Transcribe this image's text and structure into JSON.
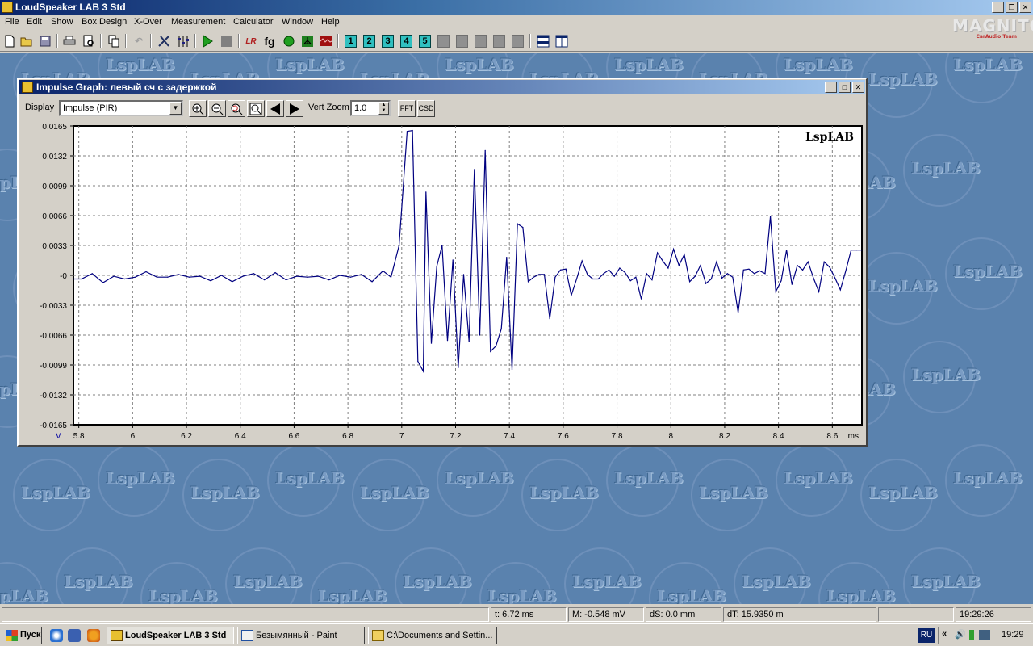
{
  "app": {
    "title": "LoudSpeaker LAB 3 Std"
  },
  "brand": {
    "logo_text": "MAGNITOLA",
    "logo_sub": "CarAudio Team"
  },
  "menu": [
    "File",
    "Edit",
    "Show",
    "Box Design",
    "X-Over",
    "Measurement",
    "Calculator",
    "Window",
    "Help"
  ],
  "toolbar": {
    "buttons": [
      "new-icon",
      "open-icon",
      "save-icon",
      "print-icon",
      "print-preview-icon",
      "copy-icon",
      "undo-icon",
      "tools-icon",
      "mixer-icon",
      "play-icon",
      "stop-icon",
      "lr-icon",
      "fg-icon",
      "circle-icon",
      "tree-icon",
      "waveform-icon"
    ],
    "lr_label": "LR",
    "fg_label": "fg",
    "number_buttons": [
      "1",
      "2",
      "3",
      "4",
      "5"
    ]
  },
  "watermark": {
    "text": "LspLAB"
  },
  "child_window": {
    "title": "Impulse Graph: левый сч с задержкой",
    "display_label": "Display",
    "display_value": "Impulse (PIR)",
    "vert_zoom_label": "Vert Zoom",
    "vert_zoom_value": "1.0",
    "fft_label": "FFT",
    "csd_label": "CSD"
  },
  "chart_data": {
    "type": "line",
    "title": "",
    "watermark": "LspLAB",
    "xlabel": "ms",
    "ylabel": "V",
    "xlim": [
      5.78,
      8.71
    ],
    "ylim": [
      -0.0165,
      0.0165
    ],
    "grid": true,
    "x_ticks": [
      "5.8",
      "6",
      "6.2",
      "6.4",
      "6.6",
      "6.8",
      "7",
      "7.2",
      "7.4",
      "7.6",
      "7.8",
      "8",
      "8.2",
      "8.4",
      "8.6"
    ],
    "y_ticks": [
      "0.0165",
      "0.0132",
      "0.0099",
      "0.0066",
      "0.0033",
      "-0",
      "-0.0033",
      "-0.0066",
      "-0.0099",
      "-0.0132",
      "-0.0165"
    ],
    "line_color": "#000080",
    "series": [
      {
        "x": [
          5.78,
          5.81,
          5.85,
          5.89,
          5.93,
          5.97,
          6.01,
          6.05,
          6.09,
          6.13,
          6.17,
          6.21,
          6.25,
          6.29,
          6.33,
          6.37,
          6.41,
          6.45,
          6.49,
          6.53,
          6.57,
          6.61,
          6.65,
          6.69,
          6.73,
          6.77,
          6.81,
          6.85,
          6.89,
          6.93,
          6.96,
          6.99,
          7.02,
          7.04,
          7.06,
          7.08,
          7.09,
          7.11,
          7.13,
          7.15,
          7.17,
          7.19,
          7.21,
          7.23,
          7.25,
          7.27,
          7.29,
          7.31,
          7.33,
          7.35,
          7.37,
          7.39,
          7.41,
          7.43,
          7.45,
          7.47,
          7.49,
          7.51,
          7.53,
          7.55,
          7.57,
          7.59,
          7.61,
          7.63,
          7.65,
          7.67,
          7.69,
          7.71,
          7.73,
          7.75,
          7.77,
          7.79,
          7.81,
          7.83,
          7.85,
          7.87,
          7.89,
          7.91,
          7.93,
          7.95,
          7.97,
          7.99,
          8.01,
          8.03,
          8.05,
          8.07,
          8.09,
          8.11,
          8.13,
          8.15,
          8.17,
          8.19,
          8.21,
          8.23,
          8.25,
          8.27,
          8.29,
          8.31,
          8.33,
          8.35,
          8.37,
          8.39,
          8.41,
          8.43,
          8.45,
          8.47,
          8.49,
          8.51,
          8.53,
          8.55,
          8.57,
          8.59,
          8.61,
          8.63,
          8.65,
          8.67,
          8.69,
          8.71
        ],
        "y": [
          -0.0004,
          -0.0004,
          0.0002,
          -0.0008,
          -0.0001,
          -0.0004,
          -0.0002,
          0.0004,
          -0.0002,
          -0.0002,
          0.0001,
          -0.0002,
          -0.0001,
          -0.0006,
          0.0,
          -0.0007,
          -0.0001,
          0.0002,
          -0.0005,
          0.0003,
          -0.0005,
          -0.0001,
          -0.0002,
          -0.0001,
          -0.0005,
          0.0,
          -0.0002,
          0.0001,
          -0.0007,
          0.0005,
          -0.0002,
          0.0033,
          0.0159,
          0.016,
          -0.0095,
          -0.0106,
          0.0092,
          -0.0075,
          0.001,
          0.0033,
          -0.0072,
          0.0017,
          -0.0102,
          0.0001,
          -0.0073,
          0.0117,
          -0.0066,
          0.0138,
          -0.0084,
          -0.0078,
          -0.0059,
          0.002,
          -0.0104,
          0.0057,
          0.0053,
          -0.0007,
          -0.0002,
          0.0001,
          0.0001,
          -0.0048,
          -0.0002,
          0.0006,
          0.0007,
          -0.0022,
          -0.0004,
          0.0016,
          0.0001,
          -0.0004,
          -0.0004,
          0.0002,
          0.0006,
          -0.0001,
          0.0008,
          0.0003,
          -0.0006,
          -0.0002,
          -0.0026,
          0.0002,
          -0.0005,
          0.0025,
          0.0016,
          0.0008,
          0.0029,
          0.0011,
          0.0023,
          -0.0007,
          -0.0001,
          0.0011,
          -0.0009,
          -0.0004,
          0.0015,
          -0.0003,
          0.0002,
          -0.0002,
          -0.0041,
          0.0006,
          0.0007,
          0.0002,
          0.0005,
          0.0002,
          0.0065,
          -0.0018,
          -0.0006,
          0.0028,
          -0.001,
          0.0011,
          0.0006,
          0.0015,
          -0.0003,
          -0.0018,
          0.0015,
          0.0009,
          -0.0003,
          -0.0016,
          0.0005,
          0.0028,
          0.0028,
          0.0028
        ]
      }
    ]
  },
  "status": {
    "t": "t: 6.72 ms",
    "m": "M: -0.548 mV",
    "ds": "dS: 0.0 mm",
    "dt": "dT: 15.9350 m",
    "clock": "19:29:26"
  },
  "taskbar": {
    "start": "Пуск",
    "tasks": [
      "LoudSpeaker LAB 3 Std",
      "Безымянный - Paint",
      "C:\\Documents and Settin..."
    ],
    "lang": "RU",
    "time": "19:29"
  }
}
